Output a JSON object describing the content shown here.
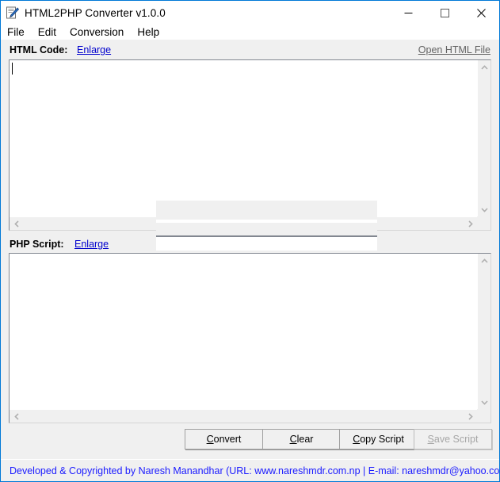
{
  "window": {
    "title": "HTML2PHP Converter v1.0.0",
    "icon": "notepad-pen-icon",
    "border_color": "#0078d7",
    "controls": {
      "minimize": "minimize-icon",
      "maximize": "maximize-icon",
      "close": "close-icon"
    }
  },
  "menubar": {
    "items": [
      {
        "label": "File"
      },
      {
        "label": "Edit"
      },
      {
        "label": "Conversion"
      },
      {
        "label": "Help"
      }
    ]
  },
  "html_section": {
    "label": "HTML Code:",
    "enlarge_link": "Enlarge",
    "open_file_link": "Open HTML File",
    "value": "",
    "placeholder": "",
    "link_color": "#0000cd",
    "muted_link_color": "#636363"
  },
  "php_section": {
    "label": "PHP Script:",
    "enlarge_link": "Enlarge",
    "value": "",
    "placeholder": ""
  },
  "buttons": {
    "convert": {
      "label": "Convert",
      "mnemonic": "C",
      "rest": "onvert",
      "disabled": false
    },
    "clear": {
      "label": "Clear",
      "mnemonic": "C",
      "rest": "lear",
      "disabled": false
    },
    "copy_script": {
      "label": "Copy Script",
      "mnemonic": "C",
      "rest": "opy Script",
      "disabled": false
    },
    "save_script": {
      "label": "Save Script",
      "mnemonic": "S",
      "rest": "ave Script",
      "disabled": true
    }
  },
  "footer": {
    "text": "Developed & Copyrighted by Naresh Manandhar (URL: www.nareshmdr.com.np  |  E-mail: nareshmdr@yahoo.com)",
    "color": "#1a1aff"
  }
}
